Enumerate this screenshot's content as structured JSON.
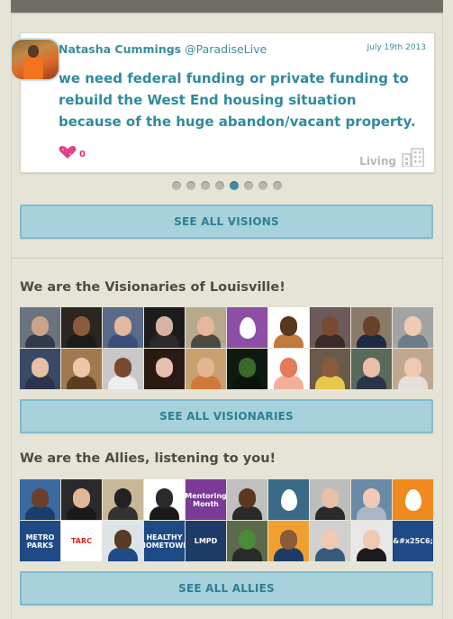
{
  "vision_card": {
    "author_name": "Natasha Cummings",
    "author_handle": "@ParadiseLive",
    "date": "July 19th 2013",
    "message": "we need federal funding or private funding to rebuild the West End housing situation because of the huge abandon/vacant property.",
    "like_count": "0",
    "category": "Living",
    "colors": {
      "accent": "#3a8d9b",
      "heart": "#e0418c"
    }
  },
  "carousel": {
    "total": 8,
    "active_index": 4
  },
  "buttons": {
    "see_all_visions": "SEE ALL VISIONS",
    "see_all_visionaries": "SEE ALL VISIONARIES",
    "see_all_allies": "SEE ALL ALLIES"
  },
  "visionaries": {
    "title": "We are the Visionaries of Louisville!",
    "tiles": [
      {
        "kind": "photo",
        "bg": "#6a7480",
        "skin": "#c9a38a",
        "shirt": "#2e3b4a"
      },
      {
        "kind": "photo",
        "bg": "#2a2622",
        "skin": "#8a5a3a",
        "shirt": "#1a1a1a"
      },
      {
        "kind": "photo",
        "bg": "#5a6a8a",
        "skin": "#e2b8a0",
        "shirt": "#3b4e7a"
      },
      {
        "kind": "photo",
        "bg": "#1c1c1c",
        "skin": "#d8b2a0",
        "shirt": "#2a2a2a"
      },
      {
        "kind": "photo",
        "bg": "#b7a98e",
        "skin": "#e6b79a",
        "shirt": "#4a4a40"
      },
      {
        "kind": "egg",
        "bg": "#8e4ea6"
      },
      {
        "kind": "photo",
        "bg": "#ffffff",
        "skin": "#5a3520",
        "shirt": "#c07a3a"
      },
      {
        "kind": "photo",
        "bg": "#6c5a5a",
        "skin": "#7a4a32",
        "shirt": "#3a2a2a"
      },
      {
        "kind": "photo",
        "bg": "#8a7a6a",
        "skin": "#6b4028",
        "shirt": "#1e2a44"
      },
      {
        "kind": "photo",
        "bg": "#a2a3a5",
        "skin": "#f0cab2",
        "shirt": "#6c7c8c"
      },
      {
        "kind": "photo",
        "bg": "#3a4a66",
        "skin": "#e6c0a6",
        "shirt": "#2b344c"
      },
      {
        "kind": "photo",
        "bg": "#a07a4e",
        "skin": "#f0c6a8",
        "shirt": "#5a3e22"
      },
      {
        "kind": "photo",
        "bg": "#c8c8c8",
        "skin": "#7a4a30",
        "shirt": "#eeeeee"
      },
      {
        "kind": "photo",
        "bg": "#2a1a14",
        "skin": "#e8c0b0",
        "shirt": "#2a1a14"
      },
      {
        "kind": "photo",
        "bg": "#c9a070",
        "skin": "#e2b690",
        "shirt": "#cf7a3a"
      },
      {
        "kind": "photo",
        "bg": "#101a10",
        "skin": "#3a6a2a",
        "shirt": "#0a140a"
      },
      {
        "kind": "photo",
        "bg": "#ffffff",
        "skin": "#e47a5a",
        "shirt": "#f2b09a"
      },
      {
        "kind": "photo",
        "bg": "#6a5a4a",
        "skin": "#8a5a3a",
        "shirt": "#e8c84a"
      },
      {
        "kind": "photo",
        "bg": "#5a6a5a",
        "skin": "#e8c0a8",
        "shirt": "#2a3448"
      },
      {
        "kind": "photo",
        "bg": "#c0a890",
        "skin": "#f0cab0",
        "shirt": "#e8e0d8"
      }
    ]
  },
  "allies": {
    "title": "We are the Allies, listening to you!",
    "tiles": [
      {
        "kind": "photo",
        "bg": "#3a6aa0",
        "skin": "#6b4028",
        "shirt": "#1c3c6a"
      },
      {
        "kind": "photo",
        "bg": "#2a2a2a",
        "skin": "#e0b898",
        "shirt": "#1a1a1a"
      },
      {
        "kind": "photo",
        "bg": "#c8b898",
        "skin": "#222222",
        "shirt": "#333333"
      },
      {
        "kind": "photo",
        "bg": "#ffffff",
        "skin": "#2a2a2a",
        "shirt": "#1a1a1a"
      },
      {
        "kind": "logo",
        "bg": "#7a3a96",
        "text": "Mentoring Month"
      },
      {
        "kind": "photo",
        "bg": "#c0c0c0",
        "skin": "#5a3820",
        "shirt": "#2a2a2a"
      },
      {
        "kind": "egg",
        "bg": "#3a6a86"
      },
      {
        "kind": "photo",
        "bg": "#bdbdbd",
        "skin": "#e8c0a8",
        "shirt": "#2a2a2a"
      },
      {
        "kind": "photo",
        "bg": "#6a8aa8",
        "skin": "#f0cab2",
        "shirt": "#a8b8c8"
      },
      {
        "kind": "egg",
        "bg": "#f08a1e"
      },
      {
        "kind": "logo",
        "bg": "#1e4a86",
        "text": "METRO PARKS"
      },
      {
        "kind": "logo",
        "bg": "#ffffff",
        "text": "TARC"
      },
      {
        "kind": "photo",
        "bg": "#dde4e8",
        "skin": "#5a3a22",
        "shirt": "#1e4a86"
      },
      {
        "kind": "logo",
        "bg": "#1e4a86",
        "text": "HEALTHY HOMETOWN"
      },
      {
        "kind": "logo",
        "bg": "#1e3a66",
        "text": "LMPD"
      },
      {
        "kind": "photo",
        "bg": "#5a6a4a",
        "skin": "#4a8a3a",
        "shirt": "#2a2a2a"
      },
      {
        "kind": "photo",
        "bg": "#f0a030",
        "skin": "#8a5a3a",
        "shirt": "#1e3a66"
      },
      {
        "kind": "photo",
        "bg": "#d0d0d0",
        "skin": "#f0cab0",
        "shirt": "#3a5a7a"
      },
      {
        "kind": "photo",
        "bg": "#e8e8e8",
        "skin": "#f0cab0",
        "shirt": "#1a1a1a"
      },
      {
        "kind": "logo",
        "bg": "#1e4a86",
        "text": "&#x25C6;"
      }
    ]
  }
}
